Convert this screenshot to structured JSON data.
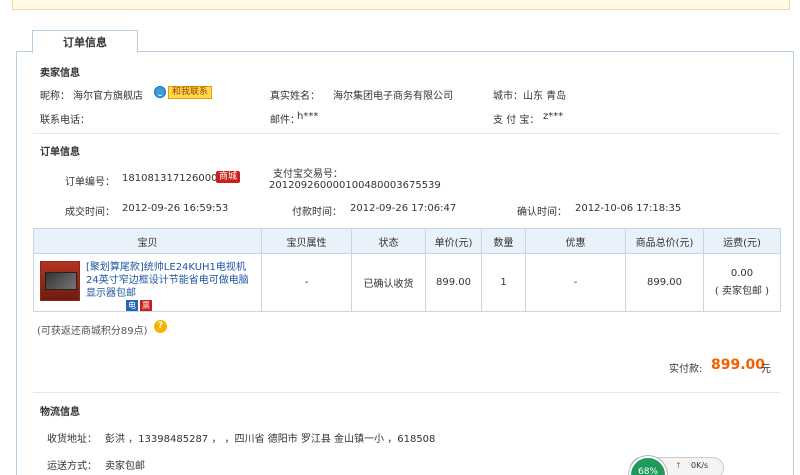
{
  "tab": {
    "title": "订单信息"
  },
  "seller": {
    "section_title": "卖家信息",
    "nickname_label": "昵称：",
    "nickname": "海尔官方旗舰店",
    "contact_button": "和我联系",
    "realname_label": "真实姓名：",
    "realname": "海尔集团电子商务有限公司",
    "city_label": "城市：",
    "city": "山东 青岛",
    "phone_label": "联系电话：",
    "email_label": "邮件：",
    "email": "h***",
    "alipay_label": "支 付 宝：",
    "alipay": "z***"
  },
  "order": {
    "section_title": "订单信息",
    "number_label": "订单编号：",
    "number": "181081317126000",
    "mall_badge": "商城",
    "alipay_trade_label": "支付宝交易号：",
    "alipay_trade": "2012092600001004800036755​39",
    "deal_time_label": "成交时间：",
    "deal_time": "2012-09-26 16:59:53",
    "pay_time_label": "付款时间：",
    "pay_time": "2012-09-26 17:06:47",
    "confirm_time_label": "确认时间：",
    "confirm_time": "2012-10-06 17:18:35"
  },
  "table": {
    "headers": [
      "宝贝",
      "宝贝属性",
      "状态",
      "单价(元)",
      "数量",
      "优惠",
      "商品总价(元)",
      "运费(元)"
    ],
    "row": {
      "name": "[聚划算尾款]统帅LE24KUH1电视机24英寸窄边框设计节能省电可做电脑显示器包邮",
      "attrs": "-",
      "status": "已确认收货",
      "price": "899.00",
      "qty": "1",
      "discount": "-",
      "total": "899.00",
      "shipping": "0.00",
      "shipping_note": "( 卖家包邮 )",
      "icon_e": "电",
      "icon_r": "票"
    }
  },
  "points_note": "(可获返还商城积分89点)",
  "payment": {
    "label": "实付款:",
    "amount": "899.00",
    "unit": "元"
  },
  "logistics": {
    "section_title": "物流信息",
    "address_label": "收货地址：",
    "address": "彭洪 ，13398485287 ， ，四川省 德阳市 罗江县 金山镇一小 ，618508",
    "method_label": "运送方式：",
    "method": "卖家包邮"
  },
  "speed_widget": {
    "percent": "68%",
    "rate": "0K/s",
    "arrow": "↑"
  },
  "colors": {
    "accent": "#f06000",
    "link": "#1f56a5",
    "header_bg": "#e9f1fa",
    "border": "#b7cfe6"
  }
}
